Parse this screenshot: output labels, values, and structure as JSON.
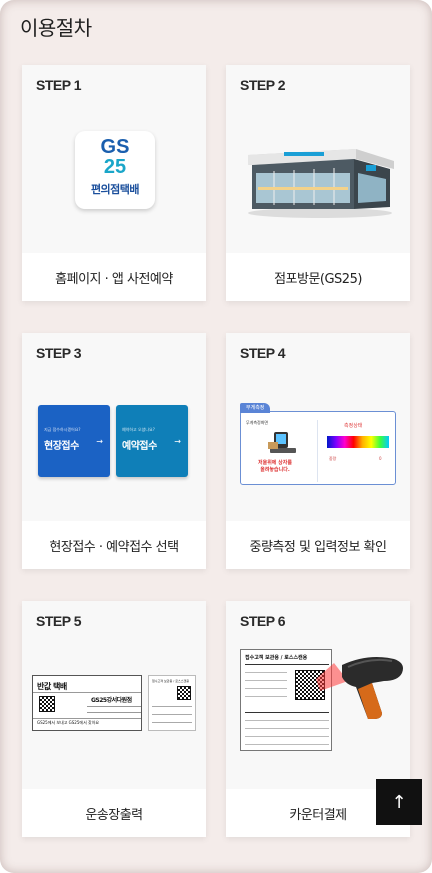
{
  "page": {
    "title": "이용절차"
  },
  "steps": [
    {
      "step": "STEP 1",
      "caption": "홈페이지 · 앱 사전예약",
      "app_icon": {
        "brand_top": "GS",
        "brand_num": "25",
        "service": "편의점택배"
      }
    },
    {
      "step": "STEP 2",
      "caption": "점포방문(GS25)"
    },
    {
      "step": "STEP 3",
      "caption": "현장접수 · 예약접수 선택",
      "choices": [
        {
          "small": "지금 접수하시겠어요?",
          "label": "현장접수",
          "color": "#1b62c4"
        },
        {
          "small": "예약하고 오셨나요?",
          "label": "예약접수",
          "color": "#0f7fb8"
        }
      ]
    },
    {
      "step": "STEP 4",
      "caption": "중량측정 및 입력정보 확인",
      "weigh": {
        "tab": "무게측정",
        "left_title": "무게측정화면",
        "message_1": "저울위에 상자를",
        "message_2": "올려놓습니다.",
        "right_title": "측정상태",
        "weight_label": "중량",
        "weight_value": "0"
      }
    },
    {
      "step": "STEP 5",
      "caption": "운송장출력",
      "waybill": {
        "title": "반값 택배",
        "store": "GS25강서다원점",
        "footer": "GS25에서 보내고 GS25에서 찾아요",
        "slip_title": "접수고객 보관용 / 로스스캔용"
      }
    },
    {
      "step": "STEP 6",
      "caption": "카운터결제",
      "receipt": {
        "title": "접수고객 보관용 / 로스스캔용"
      }
    }
  ],
  "scroll_top": {
    "label": "↑"
  }
}
